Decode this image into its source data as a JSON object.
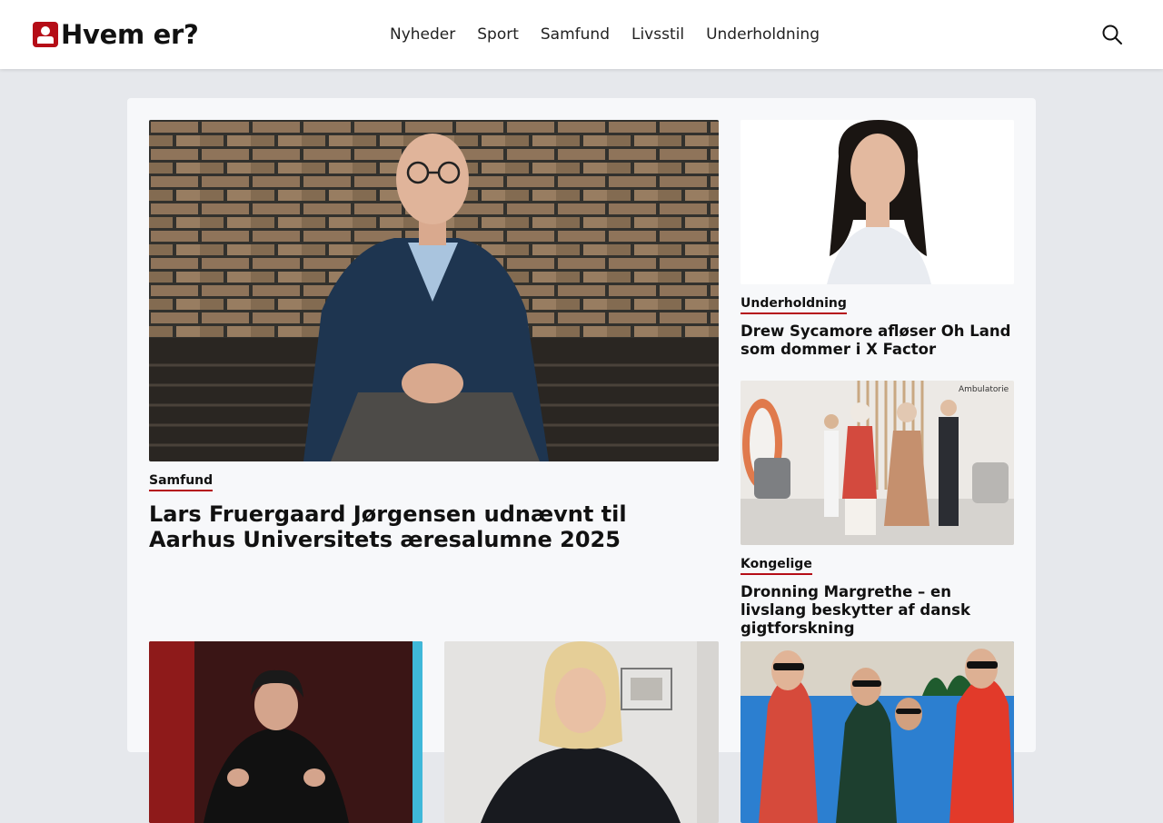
{
  "site": {
    "logo_text": "Hvem er?"
  },
  "nav": {
    "items": [
      {
        "label": "Nyheder"
      },
      {
        "label": "Sport"
      },
      {
        "label": "Samfund"
      },
      {
        "label": "Livsstil"
      },
      {
        "label": "Underholdning"
      }
    ]
  },
  "search": {
    "icon": "search-icon"
  },
  "colors": {
    "accent": "#b50d17",
    "background": "#e6e8ec",
    "panel": "#f7f8fa"
  },
  "articles": [
    {
      "category": "Samfund",
      "title": "Lars Fruergaard Jørgensen udnævnt til Aarhus Universitets æresalumne 2025"
    },
    {
      "category": "Underholdning",
      "title": "Drew Sycamore afløser Oh Land som dommer i X Factor"
    },
    {
      "category": "Kongelige",
      "title": "Dronning Margrethe – en livslang beskytter af dansk gigtforskning",
      "image_caption": "Ambulatorie"
    }
  ]
}
